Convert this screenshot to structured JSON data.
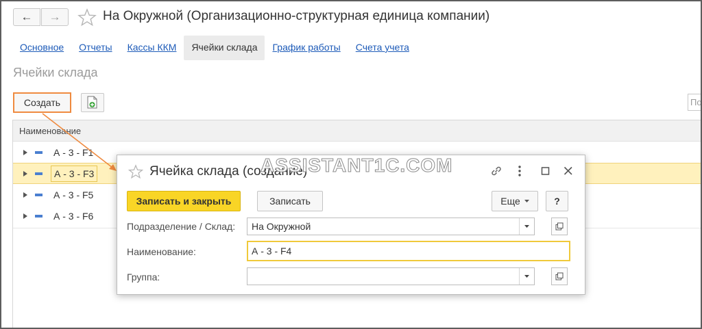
{
  "window": {
    "title": "На Окружной (Организационно-структурная единица компании)",
    "back_icon": "arrow-left-icon",
    "forward_icon": "arrow-right-icon",
    "favorite_icon": "star-outline-icon"
  },
  "tabs": [
    {
      "label": "Основное",
      "active": false
    },
    {
      "label": "Отчеты",
      "active": false
    },
    {
      "label": "Кассы ККМ",
      "active": false
    },
    {
      "label": "Ячейки склада",
      "active": true
    },
    {
      "label": "График работы",
      "active": false
    },
    {
      "label": "Счета учета",
      "active": false
    }
  ],
  "section": {
    "title": "Ячейки склада",
    "create_label": "Создать",
    "search_partial": "По"
  },
  "list": {
    "column_header": "Наименование",
    "rows": [
      {
        "label": "А - 3 - F1",
        "selected": false
      },
      {
        "label": "А - 3 - F3",
        "selected": true
      },
      {
        "label": "А - 3 - F5",
        "selected": false
      },
      {
        "label": "А - 3 - F6",
        "selected": false
      }
    ]
  },
  "watermark": "ASSISTANT1C.COM",
  "dialog": {
    "title": "Ячейка склада (создание)",
    "save_close_label": "Записать и закрыть",
    "save_label": "Записать",
    "more_label": "Еще",
    "help_label": "?",
    "fields": {
      "department_label": "Подразделение / Склад:",
      "department_value": "На Окружной",
      "name_label": "Наименование:",
      "name_value": "А - 3 - F4",
      "group_label": "Группа:",
      "group_value": ""
    }
  },
  "colors": {
    "accent_yellow": "#f9d526",
    "link_blue": "#1c5ab8",
    "highlight_orange": "#ef8a3f",
    "selected_row": "#fff1bd"
  }
}
